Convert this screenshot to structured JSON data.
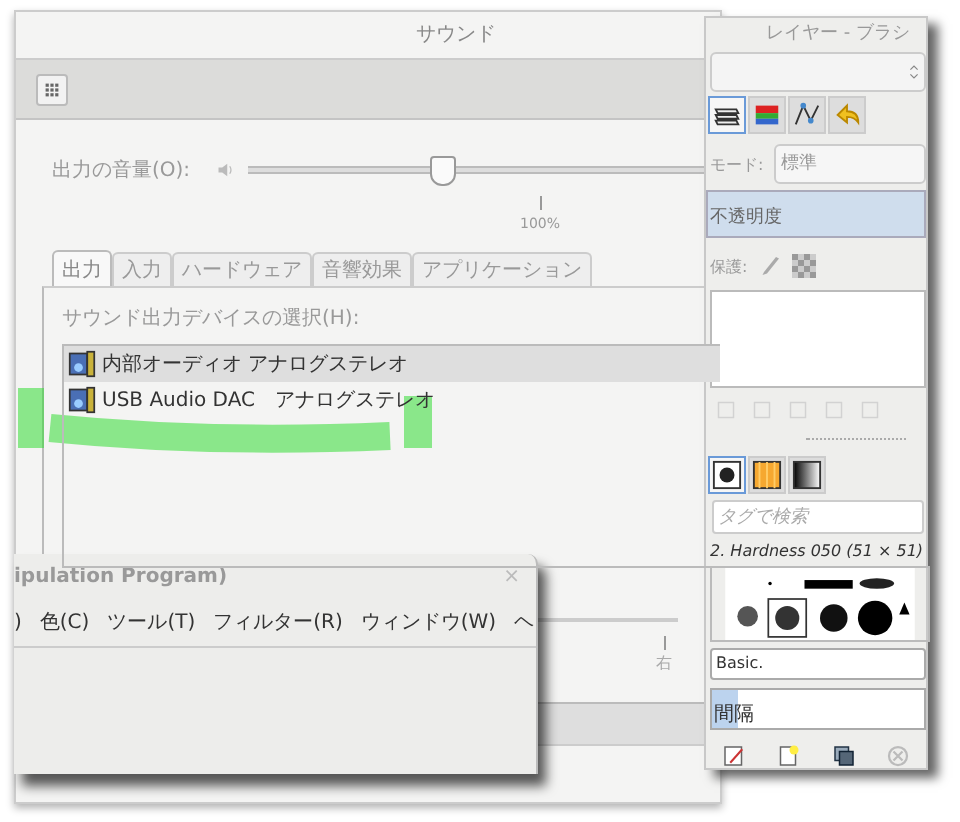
{
  "sound_window": {
    "title": "サウンド",
    "volume": {
      "label": "出力の音量(O):",
      "level": 0.42,
      "tick_label": "100%"
    },
    "tabs": [
      {
        "label": "出力",
        "selected": true
      },
      {
        "label": "入力",
        "selected": false
      },
      {
        "label": "ハードウェア",
        "selected": false
      },
      {
        "label": "音響効果",
        "selected": false
      },
      {
        "label": "アプリケーション",
        "selected": false
      }
    ],
    "device_label": "サウンド出力デバイスの選択(H):",
    "devices": [
      {
        "name": "内部オーディオ アナログステレオ",
        "selected": true
      },
      {
        "name": "USB Audio DAC　アナログステレオ",
        "selected": false
      }
    ],
    "balance_tick_label": "右"
  },
  "gimp_window": {
    "title": "ipulation Program)",
    "close": "×",
    "menu": [
      ")",
      "色(C)",
      "ツール(T)",
      "フィルター(R)",
      "ウィンドウ(W)",
      "ヘ"
    ]
  },
  "dock": {
    "title": "レイヤー - ブラシ",
    "tabs": [
      {
        "kind": "layers",
        "selected": true
      },
      {
        "kind": "channels",
        "selected": false
      },
      {
        "kind": "paths",
        "selected": false
      },
      {
        "kind": "undo",
        "selected": false
      }
    ],
    "mode_label": "モード:",
    "mode": "標準",
    "opacity": {
      "label": "不透明度",
      "level": 1
    },
    "lock_label": "保護:",
    "brush_tabs": [
      {
        "kind": "brush",
        "selected": true
      },
      {
        "kind": "pattern",
        "selected": false
      },
      {
        "kind": "gradient",
        "selected": false
      }
    ],
    "search": {
      "placeholder": "タグで検索"
    },
    "brush_name": "2. Hardness 050 (51 × 51)",
    "tag_value": "Basic.",
    "spacing": {
      "label": "間隔",
      "level": 0.12
    }
  }
}
